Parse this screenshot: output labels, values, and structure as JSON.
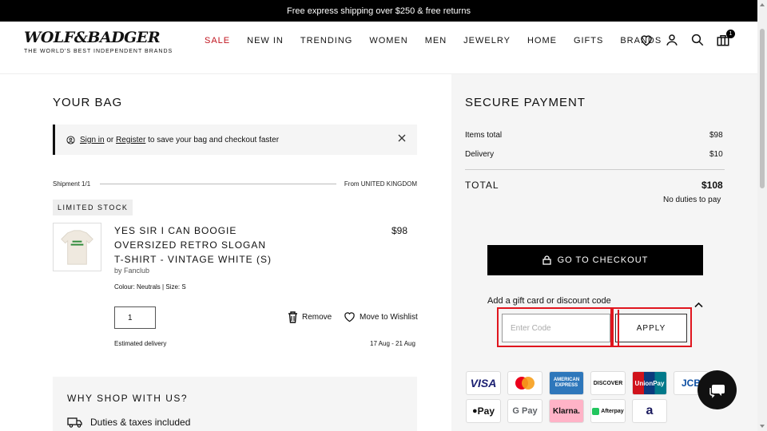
{
  "announcement": "Free express shipping over $250 & free returns",
  "logo": {
    "brand": "WOLF&BADGER",
    "tagline": "THE WORLD'S BEST INDEPENDENT BRANDS"
  },
  "nav": [
    "SALE",
    "NEW IN",
    "TRENDING",
    "WOMEN",
    "MEN",
    "JEWELRY",
    "HOME",
    "GIFTS",
    "BRANDS"
  ],
  "cart_count": "1",
  "bag": {
    "title": "YOUR BAG",
    "signin": {
      "sign_in": "Sign in",
      "or": "or",
      "register": "Register",
      "rest": "to save your bag and checkout faster"
    },
    "shipment": "Shipment 1/1",
    "from": "From UNITED KINGDOM",
    "limited": "LIMITED STOCK",
    "product": {
      "name": "YES SIR I CAN BOOGIE OVERSIZED RETRO SLOGAN T-SHIRT - VINTAGE WHITE (S)",
      "by": "by Fanclub",
      "meta": "Colour: Neutrals | Size: S",
      "price": "$98",
      "qty": "1",
      "remove": "Remove",
      "wishlist": "Move to Wishlist",
      "est_label": "Estimated delivery",
      "est_dates": "17 Aug - 21 Aug"
    }
  },
  "why": {
    "title": "WHY SHOP WITH US?",
    "item": "Duties & taxes included"
  },
  "payment": {
    "title": "SECURE PAYMENT",
    "items_label": "Items total",
    "items_value": "$98",
    "delivery_label": "Delivery",
    "delivery_value": "$10",
    "total_label": "TOTAL",
    "total_value": "$108",
    "duties": "No duties to pay",
    "checkout": "GO TO CHECKOUT",
    "gift": "Add a gift card or discount code",
    "code_placeholder": "Enter Code",
    "apply": "APPLY",
    "methods": [
      "VISA",
      "",
      "AMERICAN EXPRESS",
      "DISCOVER",
      "UnionPay",
      "JCB",
      "Pay",
      "G Pay",
      "Klarna.",
      "Afterpay",
      "a"
    ]
  }
}
